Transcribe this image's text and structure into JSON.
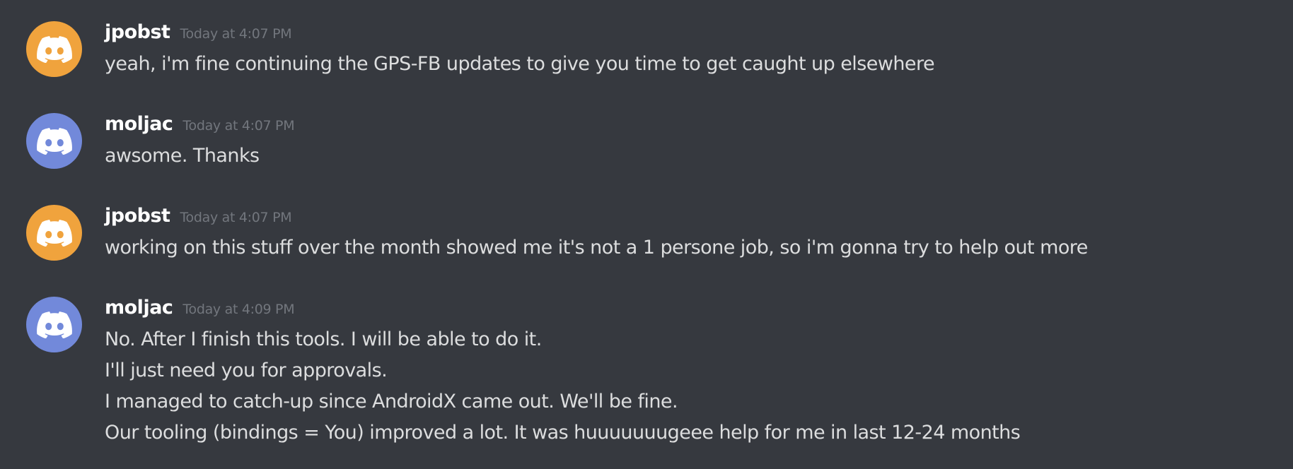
{
  "colors": {
    "background": "#36393f",
    "username": "#ffffff",
    "timestamp": "#72767d",
    "message_text": "#dcddde",
    "avatar_orange": "#f0a33d",
    "avatar_blurple": "#7289da"
  },
  "messages": [
    {
      "author": "jpobst",
      "timestamp": "Today at 4:07 PM",
      "avatar_icon": "discord-logo-icon",
      "avatar_color": "#f0a33d",
      "lines": [
        "yeah, i'm fine continuing the GPS-FB updates to give you time to get caught up elsewhere"
      ]
    },
    {
      "author": "moljac",
      "timestamp": "Today at 4:07 PM",
      "avatar_icon": "discord-logo-icon",
      "avatar_color": "#7289da",
      "lines": [
        "awsome. Thanks"
      ]
    },
    {
      "author": "jpobst",
      "timestamp": "Today at 4:07 PM",
      "avatar_icon": "discord-logo-icon",
      "avatar_color": "#f0a33d",
      "lines": [
        "working on this stuff over the month showed me it's not a 1 persone job, so i'm gonna try to help out more"
      ]
    },
    {
      "author": "moljac",
      "timestamp": "Today at 4:09 PM",
      "avatar_icon": "discord-logo-icon",
      "avatar_color": "#7289da",
      "lines": [
        "No. After I finish this tools. I will be able to do it.",
        "I'll just need you for approvals.",
        "I managed to catch-up since AndroidX came out. We'll be fine.",
        "Our tooling (bindings = You) improved a lot. It was huuuuuuugeee help for me in last 12-24 months"
      ]
    }
  ]
}
